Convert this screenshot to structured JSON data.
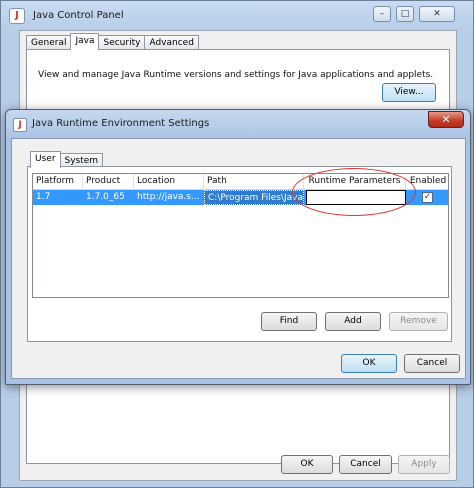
{
  "outer": {
    "title": "Java Control Panel",
    "tabs": [
      "General",
      "Java",
      "Security",
      "Advanced"
    ],
    "description": "View and manage Java Runtime versions and settings for Java applications and applets.",
    "view_button": "View...",
    "ok_button": "OK",
    "cancel_button": "Cancel",
    "apply_button": "Apply",
    "window_controls": {
      "minimize": "–",
      "maximize": "□",
      "close": "✕"
    }
  },
  "dialog": {
    "title": "Java Runtime Environment Settings",
    "close": "✕",
    "tabs": [
      "User",
      "System"
    ],
    "table": {
      "headers": [
        "Platform",
        "Product",
        "Location",
        "Path",
        "Runtime Parameters",
        "Enabled"
      ],
      "rows": [
        {
          "platform": "1.7",
          "product": "1.7.0_65",
          "location": "http://java.s...",
          "path": "C:\\Program Files\\Java\\...",
          "runtime_parameters": "",
          "enabled": "✓"
        }
      ]
    },
    "find_button": "Find",
    "add_button": "Add",
    "remove_button": "Remove",
    "ok_button": "OK",
    "cancel_button": "Cancel"
  },
  "colors": {
    "selection": "#3399ff",
    "highlight_ellipse": "#e4332a",
    "title_bar": "#b7cde8"
  },
  "icons": [
    "java-icon",
    "minimize-icon",
    "maximize-icon",
    "close-icon",
    "checkbox-icon"
  ]
}
